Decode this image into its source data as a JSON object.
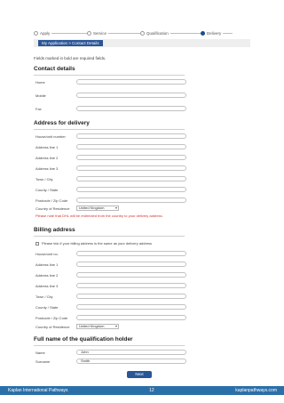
{
  "steps": [
    "Apply",
    "Service",
    "Qualification",
    "Delivery"
  ],
  "breadcrumb": "My Application > Contact Details",
  "required_note": "Fields marked in bold are required fields.",
  "contact": {
    "title": "Contact details",
    "labels": [
      "Home",
      "Mobile",
      "Fax"
    ]
  },
  "delivery": {
    "title": "Address for delivery",
    "labels": [
      "House/unit number",
      "Address line 1",
      "Address line 2",
      "Address line 3",
      "Town / City",
      "County / State",
      "Postcode / Zip Code",
      "Country of Residence"
    ],
    "country_value": "United Kingdom",
    "warning": "Please note that DHL will be redirected from the country to your delivery address."
  },
  "billing": {
    "title": "Billing address",
    "checkbox_label": "Please tick if your billing address is the same as your delivery address",
    "labels": [
      "House/unit no.",
      "Address line 1",
      "Address line 2",
      "Address line 3",
      "Town / City",
      "County / State",
      "Postcode / Zip Code",
      "Country of Residence"
    ],
    "country_value": "United Kingdom"
  },
  "holder": {
    "title": "Full name of the qualification holder",
    "labels": [
      "Name",
      "Surname"
    ],
    "values": [
      "John",
      "Smith"
    ]
  },
  "submit_label": "Next",
  "footer": {
    "left": "Kaplan International Pathways",
    "page": "12",
    "right": "kaplanpathways.com"
  },
  "colors": {
    "accent": "#2a5697",
    "footer": "#2b6fa8",
    "warning": "#d2322d"
  }
}
